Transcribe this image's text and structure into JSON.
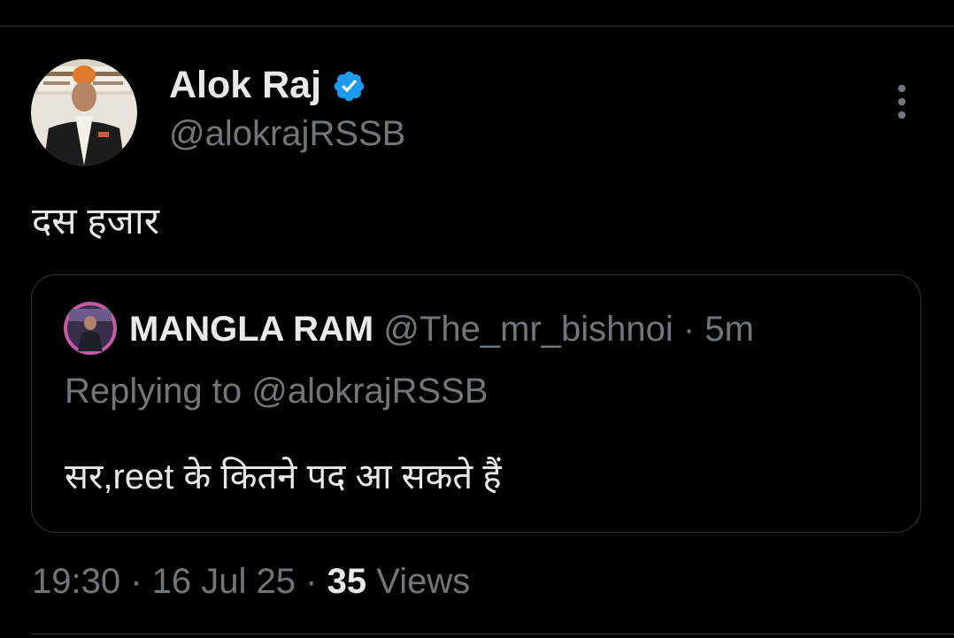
{
  "tweet": {
    "author_name": "Alok Raj",
    "author_handle": "@alokrajRSSB",
    "text": "दस हजार",
    "verified_color": "#1d9bf0"
  },
  "quoted_tweet": {
    "author_name": "MANGLA RAM",
    "author_handle": "@The_mr_bishnoi",
    "separator": "·",
    "time": "5m",
    "replying_to": "Replying to @alokrajRSSB",
    "text": "सर,reet के कितने पद आ सकते हैं"
  },
  "meta": {
    "time": "19:30",
    "sep1": "·",
    "date": "16 Jul 25",
    "sep2": "·",
    "views_count": "35",
    "views_label": "Views"
  },
  "colors": {
    "background": "#000000",
    "primary_text": "#e7e9ea",
    "secondary_text": "#71767b",
    "border": "#2f3336",
    "accent": "#1d9bf0"
  },
  "icons": {
    "verified": "verified-badge-icon",
    "more": "more-options-icon"
  }
}
